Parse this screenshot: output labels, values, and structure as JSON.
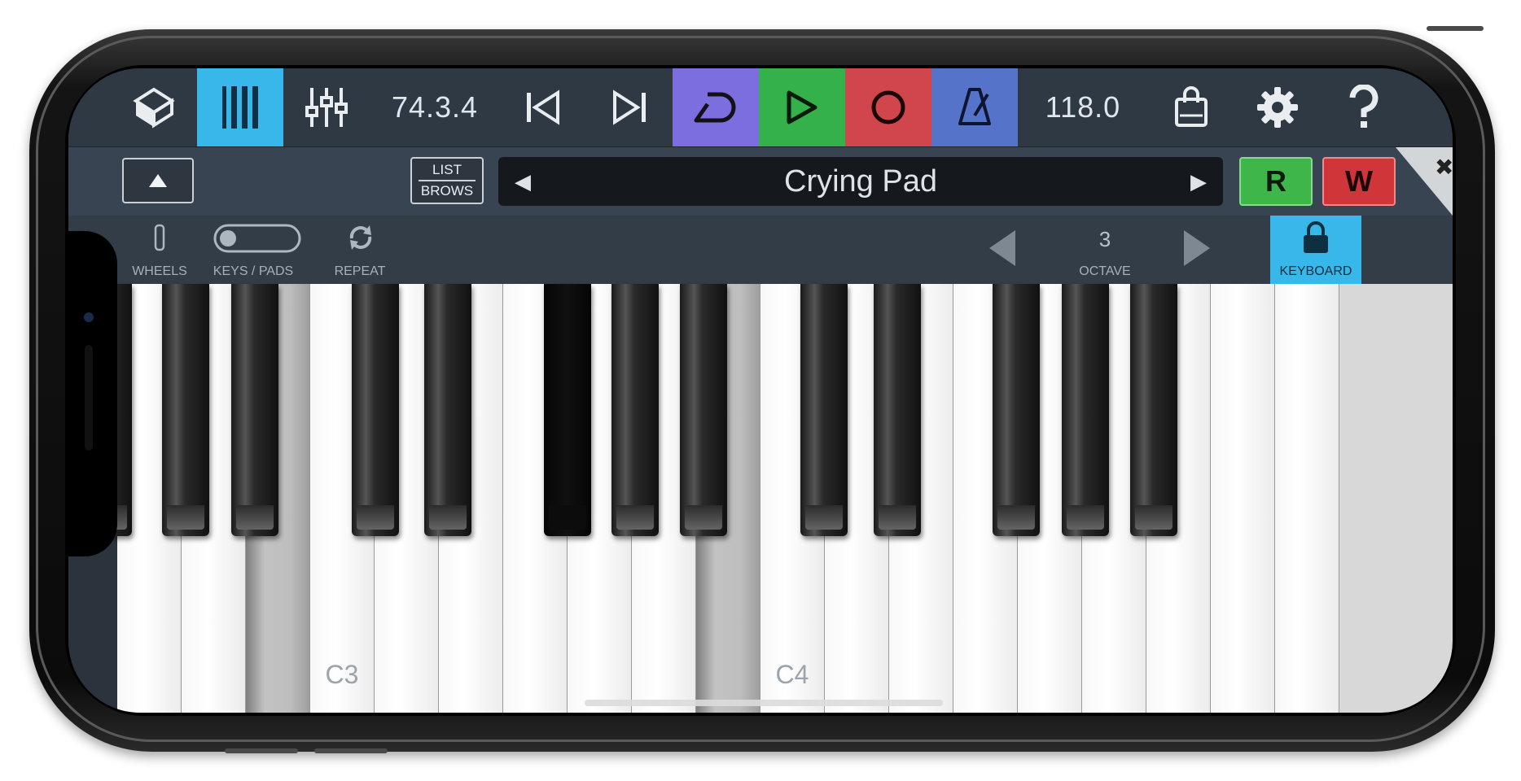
{
  "toolbar": {
    "position": "74.3.4",
    "tempo": "118.0",
    "icons": [
      "cube-icon",
      "piano-icon",
      "mixer-icon",
      "skip-back-icon",
      "skip-forward-icon",
      "loop-icon",
      "play-icon",
      "record-icon",
      "metronome-icon",
      "shop-bag-icon",
      "gear-icon",
      "help-icon"
    ],
    "colors": {
      "piano_active": "#38b7ea",
      "loop": "#7d6ee0",
      "play": "#34b14a",
      "record": "#d0464c",
      "metronome": "#5574c9"
    }
  },
  "preset_bar": {
    "list_label": "LIST",
    "browse_label": "BROWS",
    "preset_name": "Crying Pad",
    "prev_arrow": "◀",
    "next_arrow": "▶",
    "r_label": "R",
    "w_label": "W",
    "close_glyph": "✖"
  },
  "controls": {
    "wheels_label": "WHEELS",
    "keys_pads_label": "KEYS / PADS",
    "repeat_label": "REPEAT",
    "octave_value": "3",
    "octave_label": "OCTAVE",
    "keyboard_label": "KEYBOARD"
  },
  "keyboard": {
    "note_labels": [
      "C3",
      "C4"
    ],
    "pressed_keys": [
      "A2",
      "F3",
      "D3#"
    ]
  }
}
